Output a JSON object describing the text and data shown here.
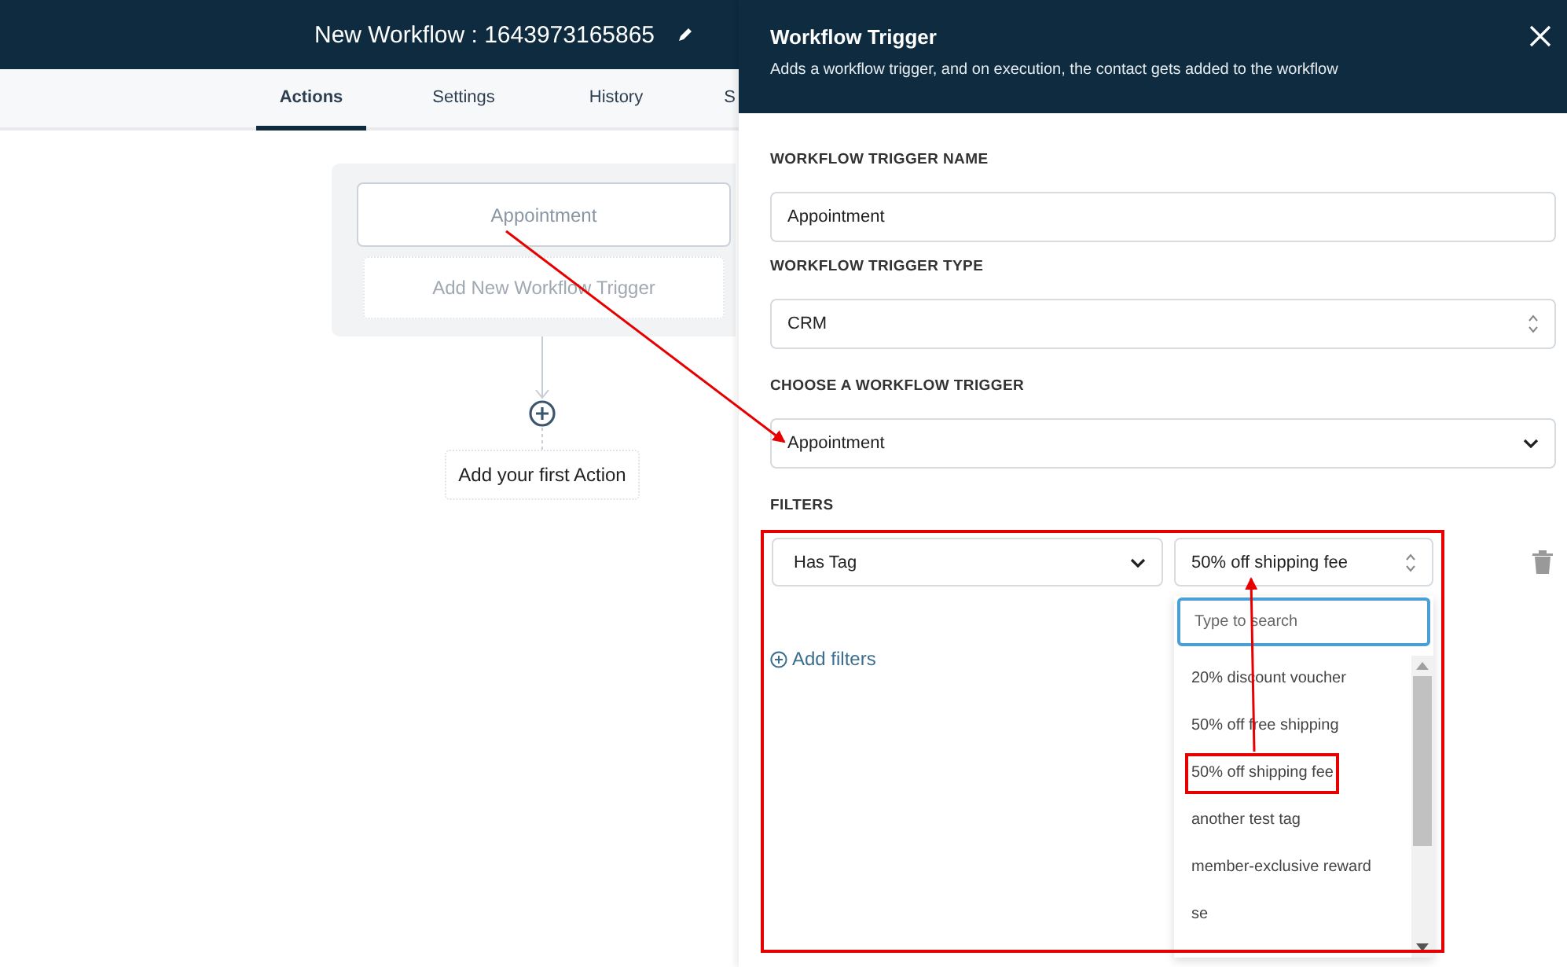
{
  "header": {
    "title": "New Workflow : 1643973165865"
  },
  "tabs": [
    {
      "label": "Actions",
      "selected": true
    },
    {
      "label": "Settings",
      "selected": false
    },
    {
      "label": "History",
      "selected": false
    },
    {
      "label": "S",
      "selected": false
    }
  ],
  "canvas": {
    "trigger": "Appointment",
    "add_trigger": "Add New Workflow Trigger",
    "add_action": "Add your first Action"
  },
  "drawer": {
    "title": "Workflow Trigger",
    "subtitle": "Adds a workflow trigger, and on execution, the contact gets added to the workflow",
    "name_label": "WORKFLOW TRIGGER NAME",
    "name_value": "Appointment",
    "type_label": "WORKFLOW TRIGGER TYPE",
    "type_value": "CRM",
    "trigger_label": "CHOOSE A WORKFLOW TRIGGER",
    "trigger_value": "Appointment",
    "filters_label": "FILTERS",
    "filter": {
      "field": "Has Tag",
      "value": "50% off shipping fee"
    },
    "add_filters": "Add filters",
    "dropdown": {
      "placeholder": "Type to search",
      "options": [
        {
          "label": "20% discount voucher",
          "annotated": false
        },
        {
          "label": "50% off free shipping",
          "annotated": false
        },
        {
          "label": "50% off shipping fee",
          "annotated": true
        },
        {
          "label": "another test tag",
          "annotated": false
        },
        {
          "label": "member-exclusive reward",
          "annotated": false
        },
        {
          "label": "se",
          "annotated": false
        }
      ]
    }
  }
}
